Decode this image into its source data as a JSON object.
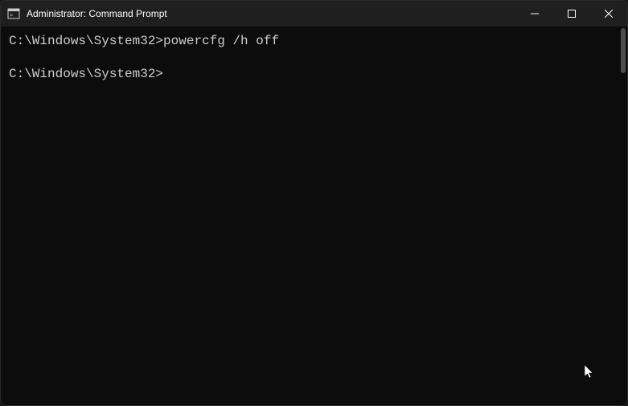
{
  "window": {
    "title": "Administrator: Command Prompt"
  },
  "terminal": {
    "lines": [
      {
        "prompt": "C:\\Windows\\System32>",
        "command": "powercfg /h off"
      },
      {
        "prompt": "C:\\Windows\\System32>",
        "command": ""
      }
    ]
  }
}
